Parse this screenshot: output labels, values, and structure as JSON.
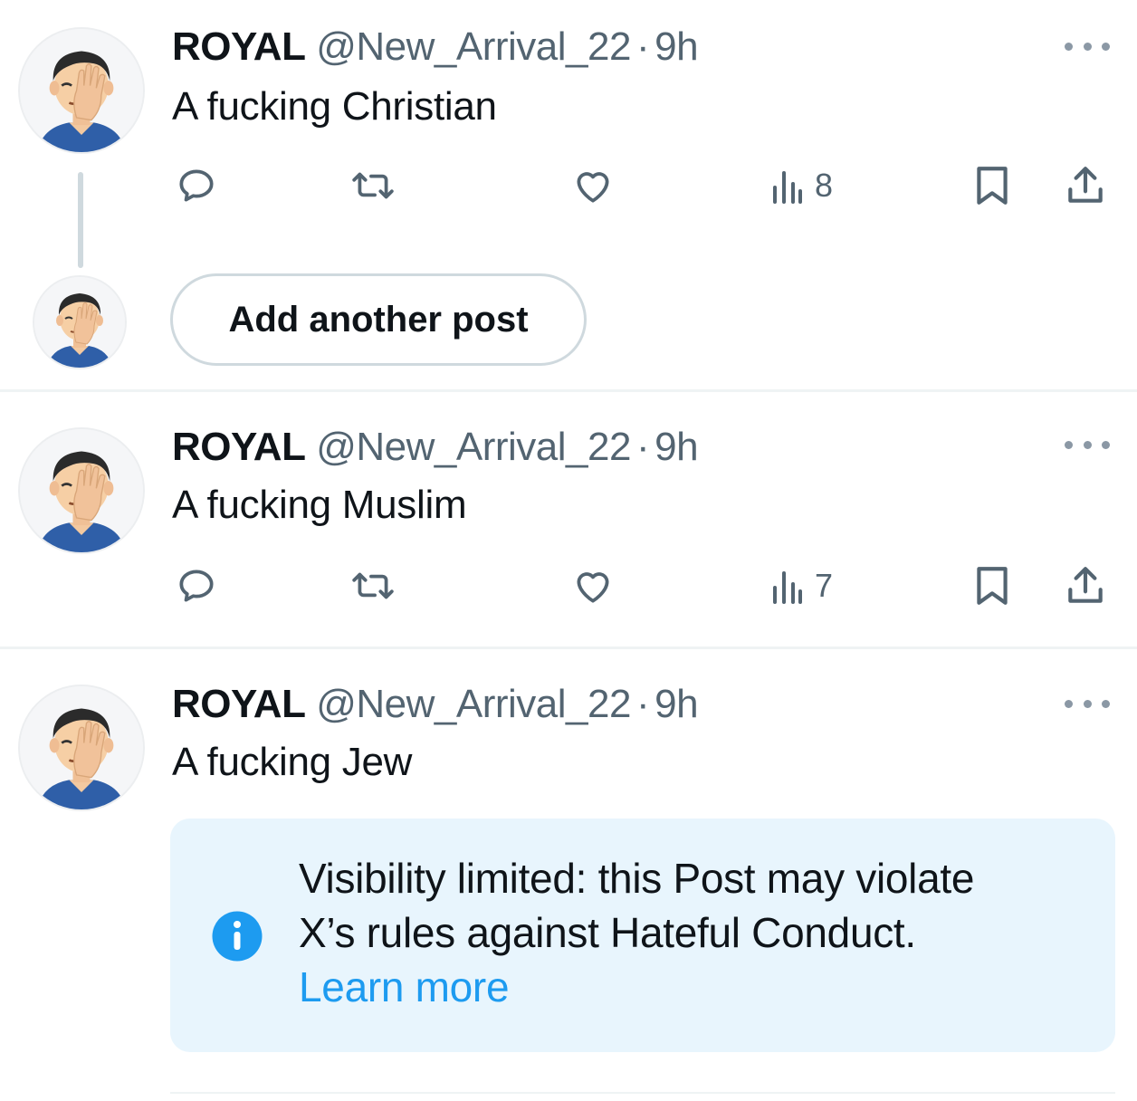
{
  "posts": [
    {
      "name": "ROYAL",
      "handle": "@New_Arrival_22",
      "separator": "·",
      "time": "9h",
      "text": "A fucking Christian",
      "views": "8",
      "avatar_icon": "facepalm-avatar-icon"
    },
    {
      "name": "ROYAL",
      "handle": "@New_Arrival_22",
      "separator": "·",
      "time": "9h",
      "text": "A fucking Muslim",
      "views": "7",
      "avatar_icon": "facepalm-avatar-icon"
    },
    {
      "name": "ROYAL",
      "handle": "@New_Arrival_22",
      "separator": "·",
      "time": "9h",
      "text": "A fucking Jew",
      "avatar_icon": "facepalm-avatar-icon"
    }
  ],
  "composer": {
    "add_post_label": "Add another post"
  },
  "notice": {
    "line1": "Visibility limited: this Post may violate",
    "line2": "X’s rules against Hateful Conduct.",
    "link": "Learn more",
    "icon": "info-icon"
  },
  "icons": [
    "reply-icon",
    "repost-icon",
    "like-icon",
    "views-icon",
    "bookmark-icon",
    "share-icon",
    "more-icon"
  ],
  "colors": {
    "text": "#0f1419",
    "secondary": "#536471",
    "accent": "#1d9bf0",
    "notice_bg": "#e8f5fd",
    "border": "#cfd9de"
  }
}
